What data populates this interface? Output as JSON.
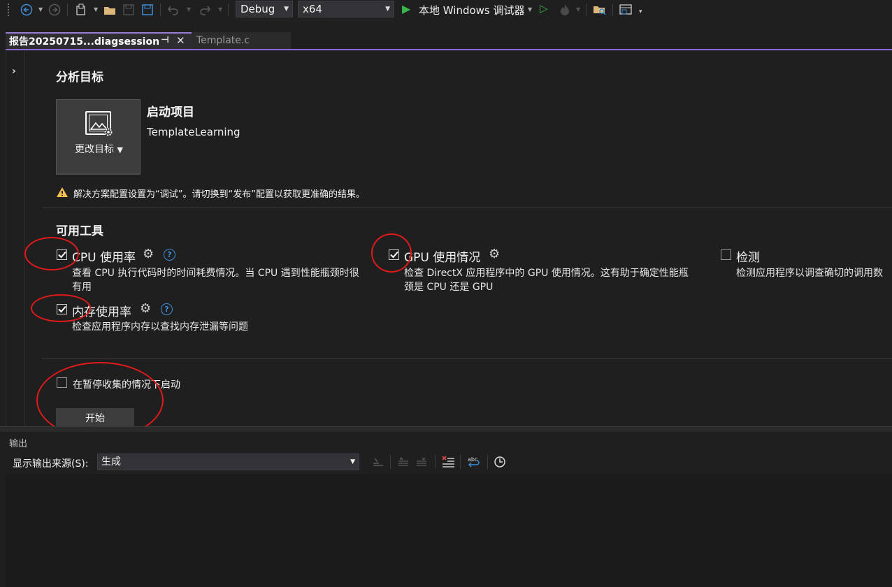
{
  "toolbar": {
    "config": "Debug",
    "platform": "x64",
    "run_label": "本地 Windows 调试器",
    "icons": [
      "back-icon",
      "forward-icon",
      "new-project-icon",
      "open-folder-icon",
      "save-icon",
      "save-all-icon",
      "undo-icon",
      "redo-icon",
      "run-icon",
      "run-without-debug-icon",
      "hot-reload-icon",
      "explorer-icon",
      "window-layout-icon"
    ]
  },
  "tabs": [
    {
      "label": "报告20250715...diagsession",
      "active": true
    },
    {
      "label": "Template.c",
      "active": false
    }
  ],
  "target": {
    "heading": "分析目标",
    "change_label": "更改目标",
    "project_title": "启动项目",
    "project_name": "TemplateLearning",
    "warning": "解决方案配置设置为“调试”。请切换到“发布”配置以获取更准确的结果。"
  },
  "tools": {
    "heading": "可用工具",
    "items": [
      {
        "label": "CPU 使用率",
        "checked": true,
        "desc_line1": "查看 CPU 执行代码时的时间耗费情况。当 CPU 遇到性能瓶颈时很",
        "desc_line2": "有用"
      },
      {
        "label": "GPU 使用情况",
        "checked": true,
        "desc_line1": "检查 DirectX 应用程序中的 GPU 使用情况。这有助于确定性能瓶",
        "desc_line2": "颈是 CPU 还是 GPU"
      },
      {
        "label": "检测",
        "checked": false,
        "desc_line1": "检测应用程序以调查确切的调用数"
      },
      {
        "label": "内存使用率",
        "checked": true,
        "desc_line1": "检查应用程序内存以查找内存泄漏等问题"
      }
    ]
  },
  "start": {
    "paused_label": "在暂停收集的情况下启动",
    "paused_checked": false,
    "button": "开始"
  },
  "output": {
    "title": "输出",
    "source_label": "显示输出来源(S):",
    "source_value": "生成"
  },
  "colors": {
    "accent": "#8a6ad6",
    "annotation": "#e01a1a",
    "run_green": "#39b54a",
    "help_blue": "#3e8ed8",
    "warning_yellow": "#f2c14e"
  }
}
